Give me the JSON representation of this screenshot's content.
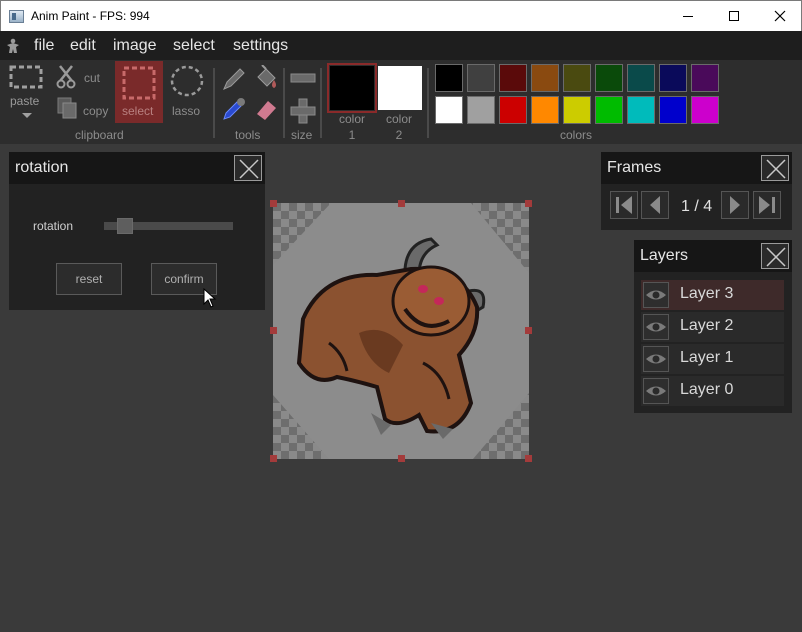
{
  "window": {
    "title": "Anim Paint - FPS: 994"
  },
  "menu": [
    "file",
    "edit",
    "image",
    "select",
    "settings"
  ],
  "toolbar": {
    "paste_label": "paste",
    "cut_label": "cut",
    "copy_label": "copy",
    "select_label": "select",
    "lasso_label": "lasso",
    "clipboard_group": "clipboard",
    "tools_group": "tools",
    "size_group": "size",
    "color1_label_a": "color",
    "color1_label_b": "1",
    "color2_label_a": "color",
    "color2_label_b": "2",
    "colors_group": "colors",
    "color1": "#000000",
    "color2": "#ffffff",
    "palette": [
      "#000000",
      "#404040",
      "#5a0a0a",
      "#8a4a10",
      "#4a4a10",
      "#0a4a0a",
      "#0a4a4a",
      "#0a0a5a",
      "#4a0a5a",
      "#ffffff",
      "#a0a0a0",
      "#cc0000",
      "#ff8800",
      "#cccc00",
      "#00bb00",
      "#00bbbb",
      "#0000cc",
      "#cc00cc"
    ]
  },
  "rotation_panel": {
    "title": "rotation",
    "slider_label": "rotation",
    "slider_value": 0.1,
    "reset_label": "reset",
    "confirm_label": "confirm"
  },
  "frames_panel": {
    "title": "Frames",
    "counter": "1 / 4"
  },
  "layers_panel": {
    "title": "Layers",
    "layers": [
      "Layer 3",
      "Layer 2",
      "Layer 1",
      "Layer 0"
    ],
    "selected_index": 0
  }
}
